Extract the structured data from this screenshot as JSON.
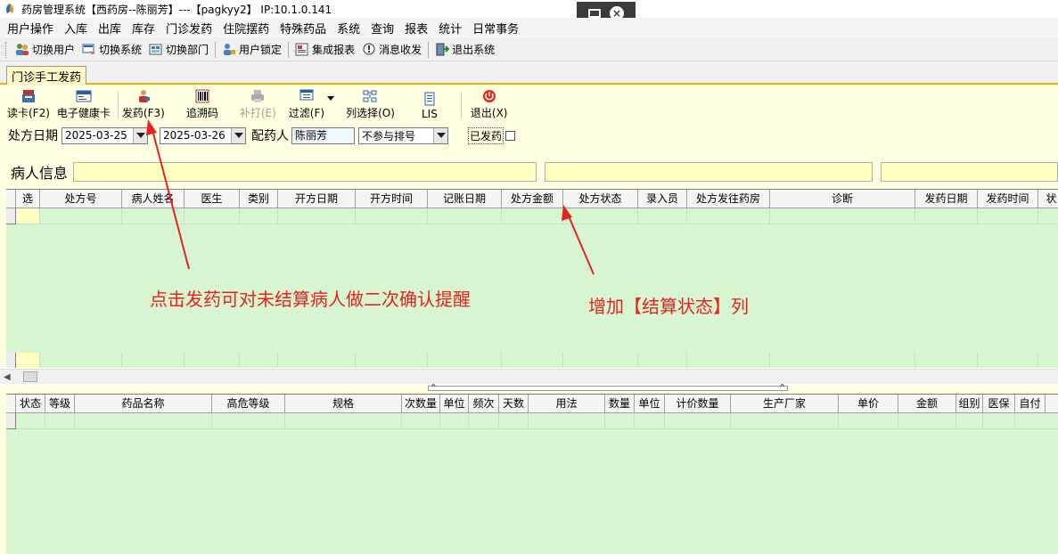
{
  "window": {
    "title": "药房管理系统【西药房--陈丽芳】---【pagkyy2】 IP:10.1.0.141"
  },
  "menu": [
    "用户操作",
    "入库",
    "出库",
    "库存",
    "门诊发药",
    "住院摆药",
    "特殊药品",
    "系统",
    "查询",
    "报表",
    "统计",
    "日常事务"
  ],
  "toolbar": {
    "switch_user": "切换用户",
    "switch_system": "切换系统",
    "switch_dept": "切换部门",
    "lock_user": "用户锁定",
    "report": "集成报表",
    "message": "消息收发",
    "exit": "退出系统"
  },
  "tab": {
    "label": "门诊手工发药"
  },
  "actions": {
    "read_card": "读卡(F2)",
    "health_card": "电子健康卡",
    "dispense": "发药(F3)",
    "trace_code": "追溯码",
    "reprint": "补打(E)",
    "filter": "过滤(F)",
    "column_select": "列选择(O)",
    "lis": "LIS",
    "exit": "退出(X)"
  },
  "filters": {
    "date_label": "处方日期",
    "date_from": "2025-03-25",
    "date_to": "2025-03-26",
    "pharmacist_label": "配药人",
    "pharmacist_value": "陈丽芳",
    "queue_option": "不参与排号",
    "dispensed_label": "已发药"
  },
  "patient": {
    "label": "病人信息"
  },
  "grid_top": {
    "columns": [
      "选",
      "处方号",
      "病人姓名",
      "医生",
      "类别",
      "开方日期",
      "开方时间",
      "记账日期",
      "处方金额",
      "处方状态",
      "录入员",
      "处方发往药房",
      "诊断",
      "发药日期",
      "发药时间",
      "状"
    ]
  },
  "grid_bottom": {
    "columns": [
      "状态",
      "等级",
      "药品名称",
      "高危等级",
      "规格",
      "次数量",
      "单位",
      "频次",
      "天数",
      "用法",
      "数量",
      "单位",
      "计价数量",
      "生产厂家",
      "单价",
      "金额",
      "组别",
      "医保",
      "自付"
    ]
  },
  "annotations": {
    "left": "点击发药可对未结算病人做二次确认提醒",
    "right": "增加【结算状态】列"
  }
}
